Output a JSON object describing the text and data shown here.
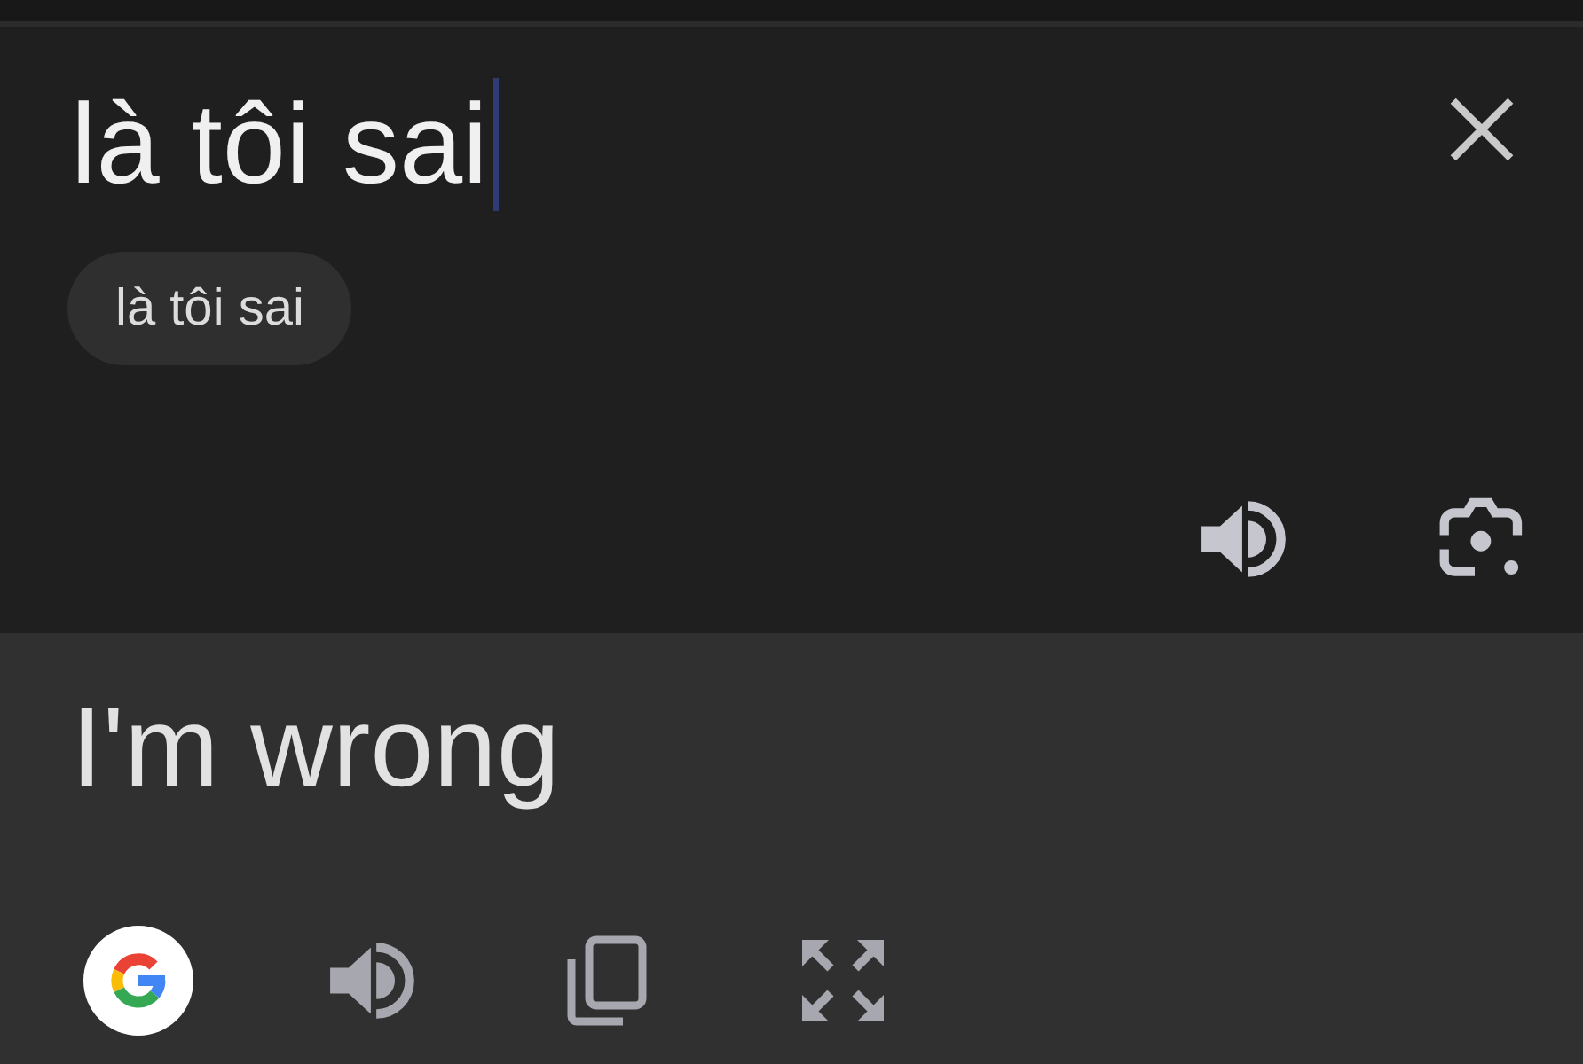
{
  "source": {
    "value": "là tôi sai",
    "focused": true
  },
  "suggestions": [
    {
      "label": "là tôi sai"
    }
  ],
  "translation": {
    "text": "I'm wrong"
  }
}
